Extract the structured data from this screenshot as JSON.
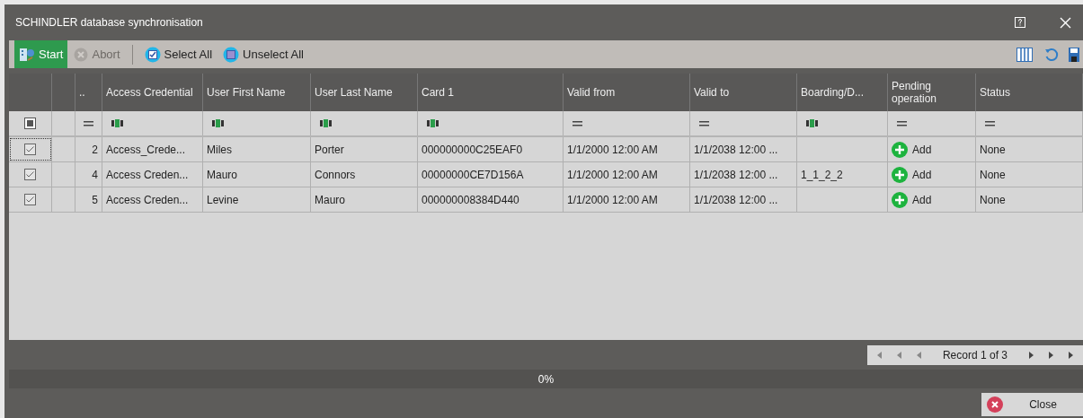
{
  "window": {
    "title": "SCHINDLER database synchronisation"
  },
  "toolbar": {
    "buttons": [
      {
        "label": "Start",
        "kind": "start",
        "disabled": false
      },
      {
        "label": "Abort",
        "kind": "abort",
        "disabled": true
      },
      {
        "label": "Select All",
        "kind": "select",
        "disabled": false
      },
      {
        "label": "Unselect All",
        "kind": "unselect",
        "disabled": false
      }
    ]
  },
  "table": {
    "columns": [
      {},
      {},
      {
        "label": ".."
      },
      {
        "label": "Access Credential"
      },
      {
        "label": "User First Name"
      },
      {
        "label": "User Last Name"
      },
      {
        "label": "Card 1"
      },
      {
        "label": "Valid from"
      },
      {
        "label": "Valid to"
      },
      {
        "label": "Boarding/D..."
      },
      {
        "label": "Pending operation"
      },
      {
        "label": "Status"
      }
    ],
    "filter_row": [
      {
        "kind": "checkbox",
        "checked": true
      },
      {
        "kind": "blank"
      },
      {
        "kind": "equals"
      },
      {
        "kind": "abc"
      },
      {
        "kind": "abc"
      },
      {
        "kind": "abc"
      },
      {
        "kind": "abc"
      },
      {
        "kind": "equals"
      },
      {
        "kind": "equals"
      },
      {
        "kind": "abc"
      },
      {
        "kind": "equals"
      },
      {
        "kind": "equals"
      }
    ],
    "rows": [
      {
        "checked": true,
        "focused": true,
        "cells": [
          "",
          "",
          "2",
          "Access_Crede...",
          "Miles",
          "Porter",
          "000000000C25EAF0",
          "1/1/2000 12:00 AM",
          "1/1/2038 12:00 ...",
          "",
          "Add",
          "None"
        ]
      },
      {
        "checked": true,
        "focused": false,
        "cells": [
          "",
          "",
          "4",
          "Access Creden...",
          "Mauro",
          "Connors",
          "00000000CE7D156A",
          "1/1/2000 12:00 AM",
          "1/1/2038 12:00 ...",
          "1_1_2_2",
          "Add",
          "None"
        ]
      },
      {
        "checked": true,
        "focused": false,
        "cells": [
          "",
          "",
          "5",
          "Access Creden...",
          "Levine",
          "Mauro",
          "000000008384D440",
          "1/1/2000 12:00 AM",
          "1/1/2038 12:00 ...",
          "",
          "Add",
          "None"
        ]
      }
    ]
  },
  "navigator": {
    "record": "Record 1 of 3"
  },
  "progress": {
    "level": 0,
    "reading": "0%"
  },
  "footer": {
    "close": "Close"
  }
}
